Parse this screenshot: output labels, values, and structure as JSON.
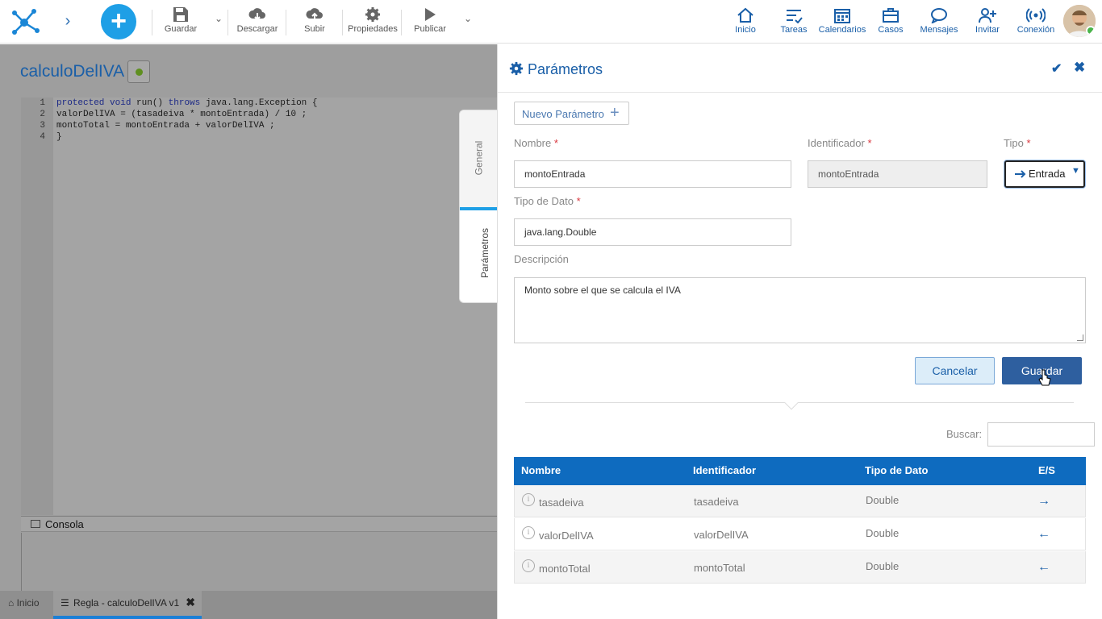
{
  "toolbar": {
    "guardar": "Guardar",
    "descargar": "Descargar",
    "subir": "Subir",
    "propiedades": "Propiedades",
    "publicar": "Publicar"
  },
  "nav": {
    "inicio": "Inicio",
    "tareas": "Tareas",
    "calendarios": "Calendarios",
    "casos": "Casos",
    "mensajes": "Mensajes",
    "invitar": "Invitar",
    "conexion": "Conexión"
  },
  "editor": {
    "title": "calculoDelIVA",
    "lines": [
      {
        "num": "1",
        "pre_kw": "protected void",
        "mid": " run() ",
        "kw2": "throws",
        "post": " java.lang.Exception {"
      },
      {
        "num": "2",
        "text": "valorDelIVA = (tasadeiva * montoEntrada) / 10 ;"
      },
      {
        "num": "3",
        "text": "montoTotal = montoEntrada + valorDelIVA ;"
      },
      {
        "num": "4",
        "text": "}"
      }
    ],
    "console_label": "Consola"
  },
  "bottom_tabs": {
    "home": "Inicio",
    "active": "Regla - calculoDelIVA v1"
  },
  "side_tabs": {
    "general": "General",
    "parametros": "Parámetros"
  },
  "panel": {
    "title": "Parámetros",
    "nuevo_parametro": "Nuevo Parámetro",
    "nombre_label": "Nombre",
    "nombre_value": "montoEntrada",
    "identificador_label": "Identificador",
    "identificador_value": "montoEntrada",
    "tipo_label": "Tipo",
    "tipo_value": "Entrada",
    "tipo_dato_label": "Tipo de Dato",
    "tipo_dato_value": "java.lang.Double",
    "descripcion_label": "Descripción",
    "descripcion_value": "Monto sobre el que se calcula el IVA",
    "required_mark": "*",
    "cancelar": "Cancelar",
    "guardar": "Guardar",
    "buscar_label": "Buscar:"
  },
  "table": {
    "headers": [
      "Nombre",
      "Identificador",
      "Tipo de Dato",
      "E/S"
    ],
    "rows": [
      {
        "nombre": "tasadeiva",
        "identificador": "tasadeiva",
        "tipo": "Double",
        "es": "→"
      },
      {
        "nombre": "valorDelIVA",
        "identificador": "valorDelIVA",
        "tipo": "Double",
        "es": "←"
      },
      {
        "nombre": "montoTotal",
        "identificador": "montoTotal",
        "tipo": "Double",
        "es": "←"
      }
    ]
  },
  "colors": {
    "brand_blue": "#1a5fa8",
    "accent_cyan": "#1e9fe6",
    "table_header": "#0e6bbf",
    "save_button": "#2e5f9f",
    "required": "#d9363e",
    "online": "#47b54a"
  }
}
